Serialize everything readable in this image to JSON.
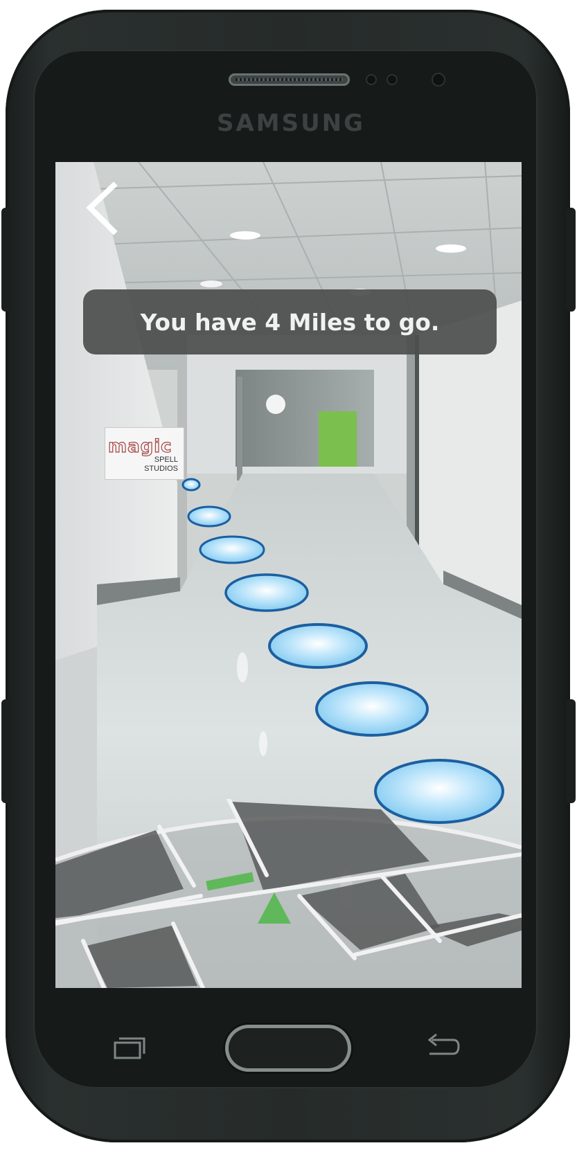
{
  "device": {
    "brand": "SAMSUNG"
  },
  "navigation": {
    "back_icon": "chevron-left-icon",
    "message": "You have 4 Miles to go."
  },
  "scene": {
    "sign": {
      "logo_text": "magic",
      "line1": "SPELL",
      "line2": "STUDIOS"
    },
    "path_markers_count": 7
  },
  "minimap": {
    "heading_icon": "navigation-arrow-icon"
  },
  "system_keys": {
    "recent_apps_icon": "recent-apps-icon",
    "home_button": "home-button",
    "back_icon": "back-arrow-icon"
  },
  "colors": {
    "marker_fill": "#8fd2f3",
    "marker_stroke": "#1b5fa0",
    "message_bg": "#4e4f4f",
    "map_arrow": "#5fb85a",
    "map_current_segment": "#5fb85a"
  }
}
